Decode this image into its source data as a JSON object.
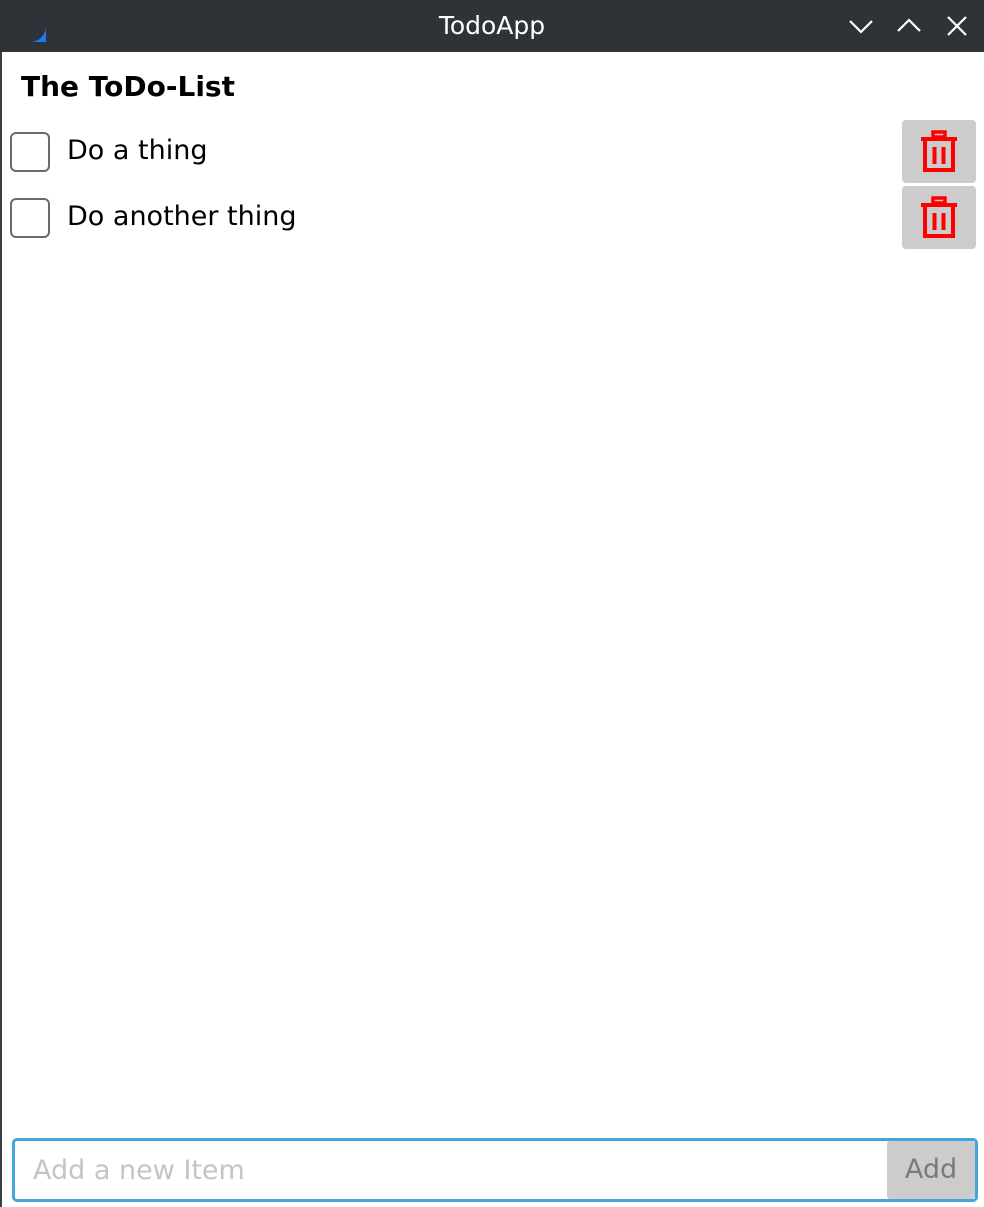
{
  "window": {
    "title": "TodoApp",
    "icon": "avalonia-app-icon",
    "controls": {
      "minimize_icon": "chevron-down-icon",
      "maximize_icon": "chevron-up-icon",
      "close_icon": "close-icon"
    }
  },
  "main": {
    "heading": "The ToDo-List",
    "items": [
      {
        "label": "Do a thing",
        "checked": false,
        "delete_icon": "trash-icon"
      },
      {
        "label": "Do another thing",
        "checked": false,
        "delete_icon": "trash-icon"
      }
    ]
  },
  "add_bar": {
    "placeholder": "Add a new Item",
    "value": "",
    "button_label": "Add"
  },
  "colors": {
    "titlebar": "#2f3237",
    "app_icon": "#1e7bf0",
    "delete_icon": "#ff0000",
    "button_bg": "#cccccc",
    "input_focus_border": "#42a5dc"
  }
}
